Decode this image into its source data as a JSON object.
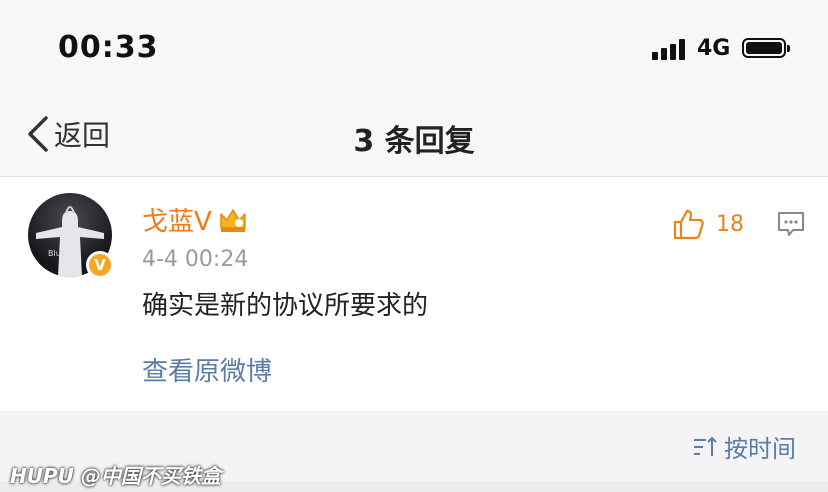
{
  "status_bar": {
    "time": "00:33",
    "network": "4G",
    "signal_icon": "cellular-signal-icon",
    "battery_icon": "battery-icon"
  },
  "nav": {
    "back_icon": "chevron-left-icon",
    "back_label": "返回",
    "title": "3 条回复"
  },
  "comment": {
    "username": "戈蓝V",
    "crown_icon": "crown-icon",
    "avatar_caption": "Blue",
    "verified_badge": "V",
    "timestamp": "4-4 00:24",
    "text": "确实是新的协议所要求的",
    "view_original": "查看原微博",
    "like_icon": "thumbs-up-icon",
    "like_count": "18",
    "reply_icon": "comment-bubble-icon"
  },
  "sort": {
    "icon": "sort-icon",
    "label": "按时间"
  },
  "watermark": "HUPU @中国不买铁盒",
  "colors": {
    "username": "#ef7a1a",
    "link": "#5b7da4",
    "like_count": "#e8831f",
    "badge": "#f5a623"
  }
}
